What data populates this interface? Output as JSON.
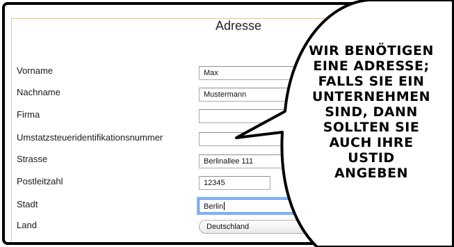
{
  "section_title": "Adresse",
  "fields": [
    {
      "label": "Vorname",
      "value": "Max"
    },
    {
      "label": "Nachname",
      "value": "Mustermann"
    },
    {
      "label": "Firma",
      "value": ""
    },
    {
      "label": "Umstatzsteueridentifikationsnummer",
      "value": ""
    },
    {
      "label": "Strasse",
      "value": "Berlinallee 111"
    },
    {
      "label": "Postleitzahl",
      "value": "12345"
    },
    {
      "label": "Stadt",
      "value": "Berlin"
    },
    {
      "label": "Land",
      "value": "Deutschland"
    }
  ],
  "speech_bubble": {
    "lines": [
      "Wir benötigen",
      "eine Adresse;",
      "falls Sie ein",
      "Unternehmen",
      "sind, dann",
      "sollten Sie",
      "auch Ihre",
      "UstID",
      "angeben"
    ]
  },
  "colors": {
    "form_border": "#f0c27a",
    "focus_ring": "#8ab7ef"
  }
}
